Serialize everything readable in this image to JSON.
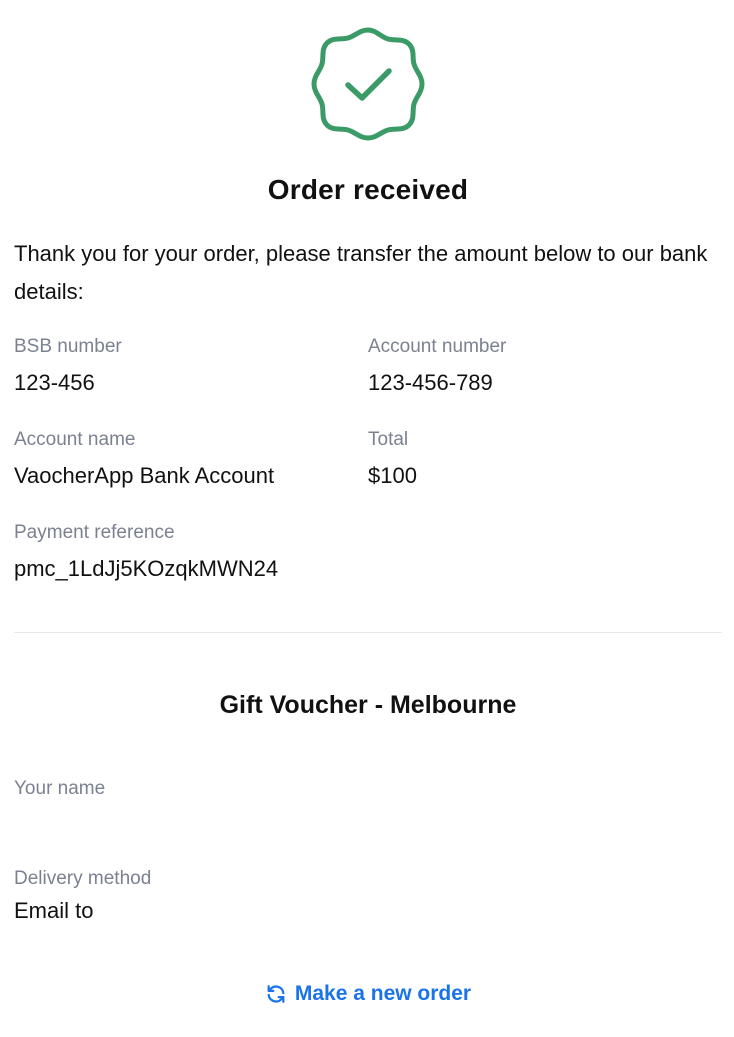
{
  "header": {
    "icon": "check-badge-icon",
    "title": "Order received"
  },
  "intro_text": "Thank you for your order, please transfer the amount below to our bank details:",
  "bank_details": {
    "bsb_label": "BSB number",
    "bsb_value": "123-456",
    "account_number_label": "Account number",
    "account_number_value": "123-456-789",
    "account_name_label": "Account name",
    "account_name_value": "VaocherApp Bank Account",
    "total_label": "Total",
    "total_value": "$100",
    "reference_label": "Payment reference",
    "reference_value": "pmc_1LdJj5KOzqkMWN24"
  },
  "voucher": {
    "title": "Gift Voucher - Melbourne",
    "your_name_label": "Your name",
    "your_name_value": "",
    "delivery_label": "Delivery method",
    "delivery_value": "Email to"
  },
  "actions": {
    "new_order_label": "Make a new order",
    "new_order_icon": "refresh-icon"
  },
  "colors": {
    "success_green": "#3a9b66",
    "link_blue": "#1a73e8",
    "label_gray": "#7b8191",
    "divider": "#e6e8eb"
  }
}
